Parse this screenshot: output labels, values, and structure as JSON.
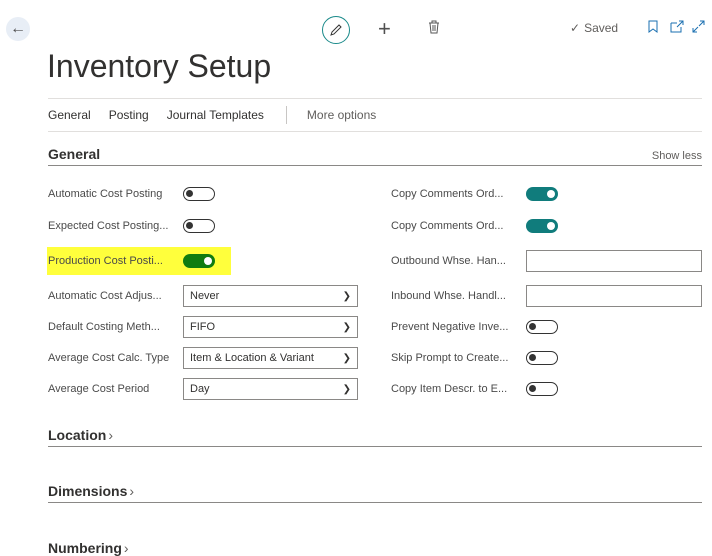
{
  "header": {
    "saved_label": "Saved",
    "page_title": "Inventory Setup"
  },
  "menu": {
    "items": [
      "General",
      "Posting",
      "Journal Templates"
    ],
    "more_options": "More options"
  },
  "general": {
    "heading": "General",
    "show_less": "Show less",
    "left_fields": [
      {
        "label": "Automatic Cost Posting",
        "type": "toggle",
        "value": "off"
      },
      {
        "label": "Expected Cost Posting...",
        "type": "toggle",
        "value": "off"
      },
      {
        "label": "Production Cost Posti...",
        "type": "toggle",
        "value": "on",
        "highlighted": true
      },
      {
        "label": "Automatic Cost Adjus...",
        "type": "select",
        "value": "Never"
      },
      {
        "label": "Default Costing Meth...",
        "type": "select",
        "value": "FIFO"
      },
      {
        "label": "Average Cost Calc. Type",
        "type": "select",
        "value": "Item & Location & Variant"
      },
      {
        "label": "Average Cost Period",
        "type": "select",
        "value": "Day"
      }
    ],
    "right_fields": [
      {
        "label": "Copy Comments Ord...",
        "type": "toggle",
        "value": "on"
      },
      {
        "label": "Copy Comments Ord...",
        "type": "toggle",
        "value": "on"
      },
      {
        "label": "Outbound Whse. Han...",
        "type": "input",
        "value": ""
      },
      {
        "label": "Inbound Whse. Handl...",
        "type": "input",
        "value": ""
      },
      {
        "label": "Prevent Negative Inve...",
        "type": "toggle",
        "value": "off"
      },
      {
        "label": "Skip Prompt to Create...",
        "type": "toggle",
        "value": "off"
      },
      {
        "label": "Copy Item Descr. to E...",
        "type": "toggle",
        "value": "off"
      }
    ]
  },
  "sections": {
    "location": "Location",
    "dimensions": "Dimensions",
    "numbering": "Numbering"
  },
  "colors": {
    "toggle_on": "#107c7c",
    "toggle_on_highlighted": "#107c10",
    "highlight": "#ffff3c"
  }
}
